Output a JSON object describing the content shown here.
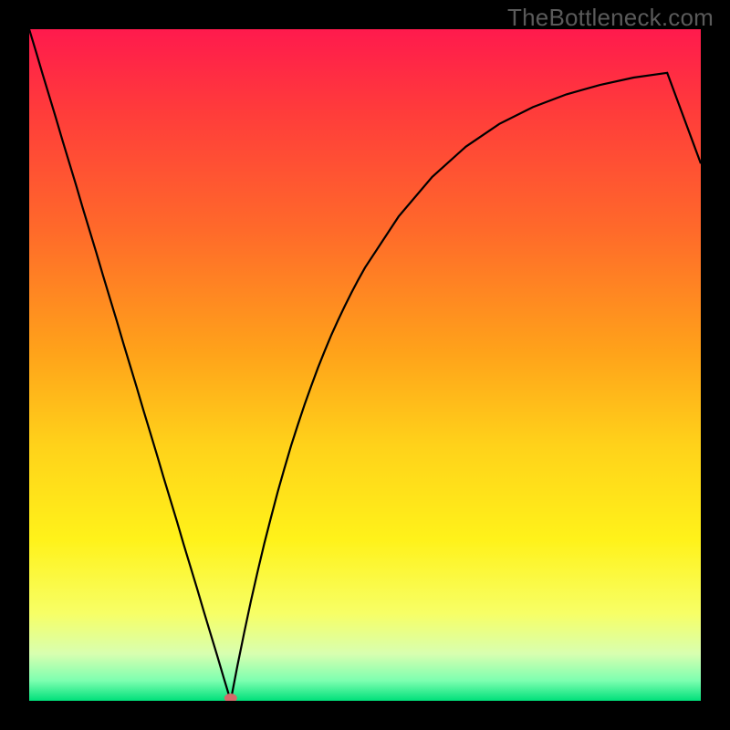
{
  "watermark": "TheBottleneck.com",
  "chart_data": {
    "type": "line",
    "title": "",
    "xlabel": "",
    "ylabel": "",
    "xlim": [
      0,
      100
    ],
    "ylim": [
      0,
      100
    ],
    "x": [
      0,
      1,
      2,
      3,
      4,
      5,
      6,
      7,
      8,
      9,
      10,
      11,
      12,
      13,
      14,
      15,
      16,
      17,
      18,
      19,
      20,
      21,
      22,
      23,
      24,
      25,
      26,
      27,
      28,
      29,
      30,
      31,
      32,
      33,
      34,
      35,
      36,
      37,
      38,
      39,
      40,
      41,
      42,
      43,
      44,
      45,
      46,
      47,
      48,
      49,
      50,
      55,
      60,
      65,
      70,
      75,
      80,
      85,
      90,
      95,
      100
    ],
    "values": [
      100,
      96.7,
      93.3,
      90.0,
      86.7,
      83.3,
      80.0,
      76.7,
      73.3,
      70.0,
      66.7,
      63.3,
      60.0,
      56.7,
      53.3,
      50.0,
      46.7,
      43.3,
      40.0,
      36.7,
      33.3,
      30.0,
      26.7,
      23.3,
      20.0,
      16.7,
      13.3,
      10.0,
      6.7,
      3.3,
      0.0,
      5.2,
      10.1,
      14.8,
      19.2,
      23.4,
      27.3,
      31.1,
      34.6,
      38.0,
      41.1,
      44.1,
      46.9,
      49.6,
      52.1,
      54.5,
      56.7,
      58.8,
      60.8,
      62.7,
      64.5,
      72.1,
      78.0,
      82.5,
      85.9,
      88.4,
      90.3,
      91.7,
      92.8,
      93.5,
      80.0
    ],
    "optimum_marker": {
      "x": 30,
      "y": 0
    },
    "marker_color": "#d46a6a",
    "gradient_stops": [
      {
        "offset": 0.0,
        "color": "#ff1a4d"
      },
      {
        "offset": 0.12,
        "color": "#ff3b3b"
      },
      {
        "offset": 0.3,
        "color": "#ff6a2a"
      },
      {
        "offset": 0.48,
        "color": "#ffa21a"
      },
      {
        "offset": 0.62,
        "color": "#ffd21a"
      },
      {
        "offset": 0.76,
        "color": "#fff21a"
      },
      {
        "offset": 0.87,
        "color": "#f7ff66"
      },
      {
        "offset": 0.93,
        "color": "#d8ffb0"
      },
      {
        "offset": 0.97,
        "color": "#7dffb0"
      },
      {
        "offset": 1.0,
        "color": "#00e07a"
      }
    ]
  }
}
